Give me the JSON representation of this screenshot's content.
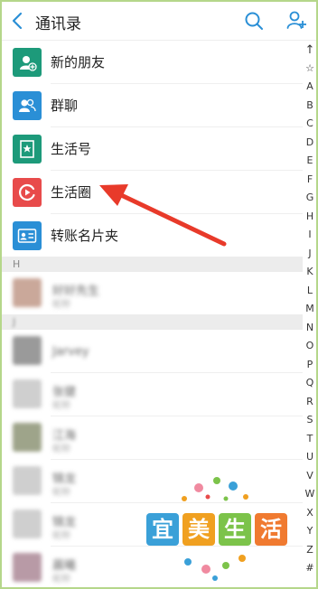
{
  "header": {
    "title": "通讯录",
    "back_icon": "chevron-left-icon",
    "search_icon": "search-icon",
    "add_user_icon": "add-user-icon"
  },
  "fixed_items": [
    {
      "label": "新的朋友",
      "icon": "new-friend-icon",
      "color": "#1d9a7a"
    },
    {
      "label": "群聊",
      "icon": "group-chat-icon",
      "color": "#2a8fd6"
    },
    {
      "label": "生活号",
      "icon": "life-account-icon",
      "color": "#1d9a7a"
    },
    {
      "label": "生活圈",
      "icon": "life-circle-icon",
      "color": "#e84b4b"
    },
    {
      "label": "转账名片夹",
      "icon": "card-holder-icon",
      "color": "#2a8fd6"
    }
  ],
  "sections": [
    {
      "letter": "H"
    },
    {
      "letter": "J"
    }
  ],
  "contacts": [
    {
      "name": "好好先生",
      "sub": "昵称",
      "color": "#caa89a"
    },
    {
      "name": "Jarvey",
      "sub": "",
      "color": "#9a9a9a"
    },
    {
      "name": "张健",
      "sub": "昵称",
      "color": "#cfcfcf"
    },
    {
      "name": "江海",
      "sub": "昵称",
      "color": "#9ea48a"
    },
    {
      "name": "锦龙",
      "sub": "昵称",
      "color": "#cfcfcf"
    },
    {
      "name": "锦龙",
      "sub": "昵称",
      "color": "#cfcfcf"
    },
    {
      "name": "晨曦",
      "sub": "昵称",
      "color": "#b89aa6"
    }
  ],
  "index_letters": [
    "↑",
    "☆",
    "A",
    "B",
    "C",
    "D",
    "E",
    "F",
    "G",
    "H",
    "I",
    "J",
    "K",
    "L",
    "M",
    "N",
    "O",
    "P",
    "Q",
    "R",
    "S",
    "T",
    "U",
    "V",
    "W",
    "X",
    "Y",
    "Z",
    "#"
  ],
  "watermark": {
    "chars": [
      "宜",
      "美",
      "生",
      "活"
    ],
    "colors": [
      "#3aa0d8",
      "#f0a020",
      "#7cc34a",
      "#f07a30"
    ]
  },
  "annotation": {
    "color": "#e83a2a"
  }
}
